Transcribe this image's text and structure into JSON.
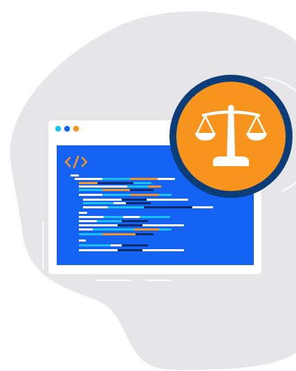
{
  "illustration": {
    "colors": {
      "blob": "#e6e6e8",
      "browser_frame": "#ffffff",
      "code_panel": "#1463f5",
      "code_text": "#ffffff",
      "code_dark": "#0e2a66",
      "code_cyan": "#19c4ec",
      "code_orange": "#f7941d",
      "badge_ring": "#0d3d79",
      "badge_fill": "#f7941d",
      "scale_icon": "#ffffff"
    },
    "window_dots": [
      "#19c4ec",
      "#1463f5",
      "#f7941d"
    ],
    "code_icon": "code-brackets-icon",
    "badge_icon": "balance-scale-icon"
  }
}
